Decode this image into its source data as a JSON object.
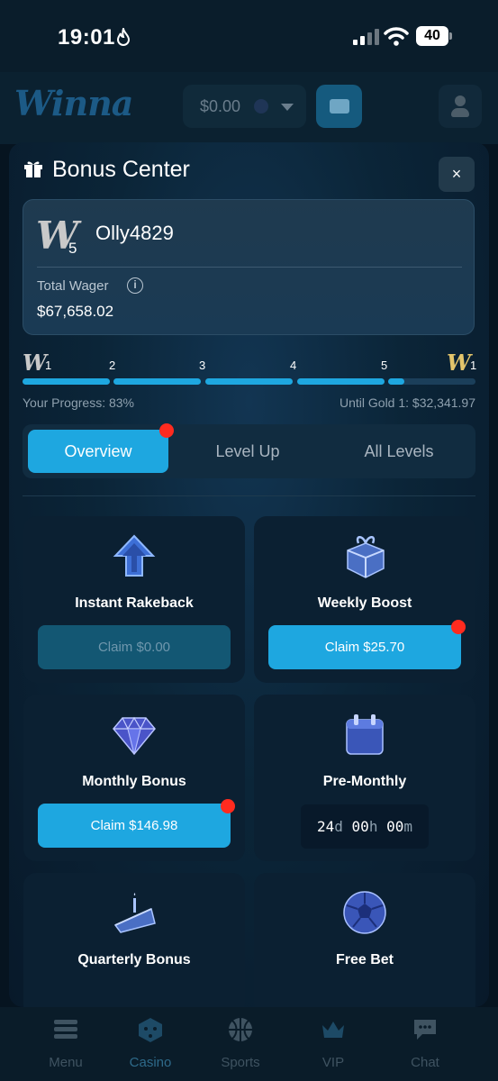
{
  "status_bar": {
    "time": "19:01",
    "battery": "40"
  },
  "header": {
    "logo": "Winna",
    "balance": "$0.00"
  },
  "modal": {
    "title": "Bonus Center",
    "close": "×",
    "user": {
      "rank_letter": "W",
      "rank_level": "5",
      "username": "Olly4829",
      "wager_label": "Total Wager",
      "wager_value": "$67,658.02"
    },
    "progress": {
      "start_letter": "W",
      "start_level": "1",
      "levels": [
        "2",
        "3",
        "4",
        "5"
      ],
      "end_letter": "W",
      "end_level": "1",
      "percent": 83,
      "progress_label": "Your Progress: 83%",
      "until_label": "Until Gold 1: $32,341.97"
    },
    "tabs": [
      "Overview",
      "Level Up",
      "All Levels"
    ],
    "active_tab": "Overview",
    "tiles": [
      {
        "title": "Instant Rakeback",
        "button": "Claim $0.00",
        "icon": "arrow-up-icon"
      },
      {
        "title": "Weekly Boost",
        "button": "Claim $25.70",
        "icon": "gift-box-icon"
      },
      {
        "title": "Monthly Bonus",
        "button": "Claim $146.98",
        "icon": "diamond-icon"
      },
      {
        "title": "Pre-Monthly",
        "countdown": {
          "days": "24",
          "d": "d",
          "hours": "00",
          "h": "h",
          "minutes": "00",
          "m": "m"
        },
        "icon": "calendar-icon"
      },
      {
        "title": "Quarterly Bonus",
        "icon": "cake-icon"
      },
      {
        "title": "Free Bet",
        "icon": "soccer-ball-icon"
      }
    ]
  },
  "bottom_nav": [
    "Menu",
    "Casino",
    "Sports",
    "VIP",
    "Chat"
  ],
  "colors": {
    "accent": "#1ea7e0",
    "alert": "#ff2b1f",
    "gold": "#e3c56b"
  }
}
